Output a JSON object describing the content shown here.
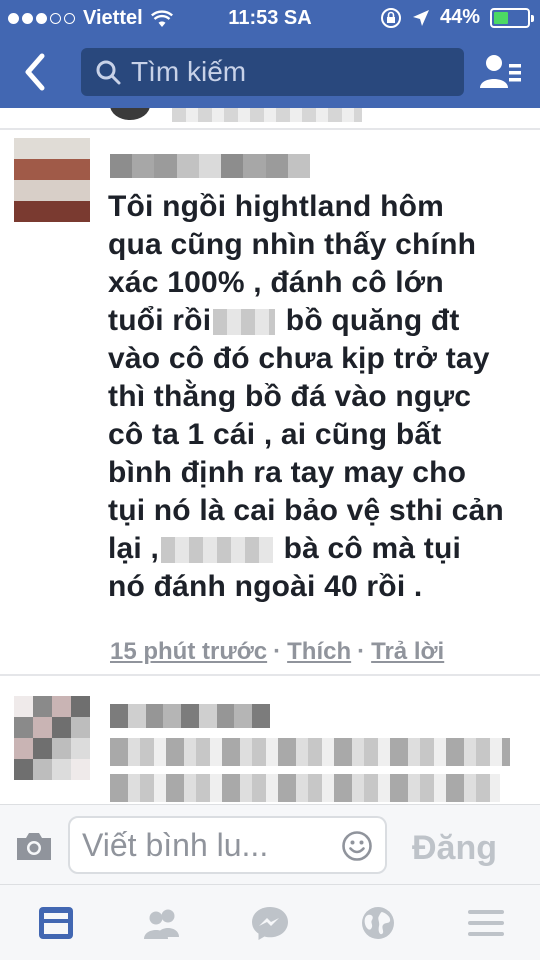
{
  "status_bar": {
    "carrier": "Viettel",
    "time": "11:53 SA",
    "battery_pct": "44%",
    "battery_level": 0.44,
    "signal_bars": 3
  },
  "nav": {
    "search_placeholder": "Tìm kiếm"
  },
  "comment_main": {
    "lines": [
      "Tôi ngồi hightland hôm",
      "qua cũng nhìn thấy chính",
      "xác 100% , đánh cô lớn",
      "tuổi rồi",
      "bồ quăng đt",
      "vào cô đó chưa kịp trở tay",
      "thì thằng bồ đá vào ngực",
      "cô ta 1 cái , ai cũng bất",
      "bình định ra tay may cho",
      "tụi nó là cai bảo vệ sthi cản",
      "lại ,",
      "bà cô mà tụi",
      "nó đánh ngoài 40 rồi ."
    ],
    "time_ago": "15 phút trước",
    "like_label": "Thích",
    "reply_label": "Trả lời",
    "separator": "·"
  },
  "composer": {
    "placeholder": "Viết bình lu...",
    "post_label": "Đăng"
  },
  "colors": {
    "header_blue": "#4267b2",
    "search_bg": "#29487d",
    "active_tab": "#4267b2",
    "inactive_tab": "#bec3c9"
  },
  "icons": {
    "back": "chevron-left-icon",
    "search": "search-icon",
    "friends": "friend-requests-icon",
    "camera": "camera-icon",
    "emoji": "smiley-icon",
    "tabs": [
      "news-feed-icon",
      "friends-icon",
      "messenger-icon",
      "globe-icon",
      "menu-icon"
    ]
  }
}
